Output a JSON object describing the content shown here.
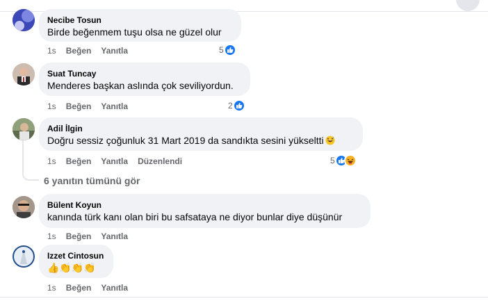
{
  "comments": [
    {
      "author": "Necibe Tosun",
      "text": "Birde beğenmem tuşu olsa ne güzel olur",
      "time": "1s",
      "like": "Beğen",
      "reply": "Yanıtla",
      "reactions": "5"
    },
    {
      "author": "Suat Tuncay",
      "text": "Menderes başkan aslında çok seviliyordun.",
      "time": "1s",
      "like": "Beğen",
      "reply": "Yanıtla",
      "reactions": "2"
    },
    {
      "author": "Adil İlgin",
      "text": "Doğru sessiz çoğunluk 31 Mart 2019 da sandıkta sesini yükseltti",
      "time": "1s",
      "like": "Beğen",
      "reply": "Yanıtla",
      "edited": "Düzenlendi",
      "reactions": "5"
    },
    {
      "author": "Bülent Koyun",
      "text": "kanında türk kanı olan biri bu safsataya ne diyor bunlar diye düşünür",
      "time": "1s",
      "like": "Beğen",
      "reply": "Yanıtla"
    },
    {
      "author": "Izzet Cintosun",
      "text": "👍👏👏👏",
      "time": "1s",
      "like": "Beğen",
      "reply": "Yanıtla"
    }
  ],
  "replies_link": "6 yanıtın tümünü gör",
  "colors": {
    "accent": "#1877f2",
    "bubble": "#f0f2f5",
    "muted": "#65676b"
  },
  "icons": [
    "like-reaction-icon",
    "haha-reaction-icon",
    "grinning-sweat-emoji-icon"
  ]
}
